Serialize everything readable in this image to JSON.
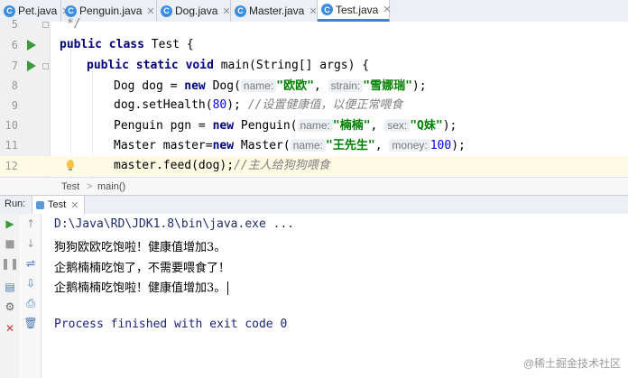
{
  "tabs": [
    {
      "label": "Pet.java",
      "icon": "class-c-icon"
    },
    {
      "label": "Penguin.java",
      "icon": "class-c-icon"
    },
    {
      "label": "Dog.java",
      "icon": "class-c-icon"
    },
    {
      "label": "Master.java",
      "icon": "class-c-icon"
    },
    {
      "label": "Test.java",
      "icon": "class-c-icon",
      "active": true
    }
  ],
  "editor": {
    "lines": [
      {
        "num": "5",
        "text": "*/"
      },
      {
        "num": "6",
        "text": "public class Test {"
      },
      {
        "num": "7",
        "text": "public static void main(String[] args) {"
      },
      {
        "num": "8",
        "text": "Dog dog = new Dog( name: \"欧欧\",  strain: \"雪娜瑞\");"
      },
      {
        "num": "9",
        "text": "dog.setHealth(80); //设置健康值，以便正常喂食"
      },
      {
        "num": "10",
        "text": "Penguin pgn = new Penguin( name: \"楠楠\",  sex: \"Q妹\");"
      },
      {
        "num": "11",
        "text": "Master master=new Master( name: \"王先生\", money: 100);"
      },
      {
        "num": "12",
        "text": "master.feed(dog);//主人给狗狗喂食"
      }
    ],
    "tokens": {
      "l5": "*/",
      "l6_kw1": "public",
      "l6_kw2": "class",
      "l6_rest": " Test {",
      "l7_kw1": "public",
      "l7_kw2": "static",
      "l7_kw3": "void",
      "l7_rest": " main(String[] args) {",
      "l8_a": "Dog dog = ",
      "l8_new": "new",
      "l8_b": " Dog(",
      "l8_h1": "name:",
      "l8_s1": "\"欧欧\"",
      "l8_c": ", ",
      "l8_h2": "strain:",
      "l8_s2": "\"雪娜瑞\"",
      "l8_d": ");",
      "l9_a": "dog.setHealth(",
      "l9_n": "80",
      "l9_b": "); ",
      "l9_cmt": "//设置健康值，以便正常喂食",
      "l10_a": "Penguin pgn = ",
      "l10_new": "new",
      "l10_b": " Penguin(",
      "l10_h1": "name:",
      "l10_s1": "\"楠楠\"",
      "l10_c": ", ",
      "l10_h2": "sex:",
      "l10_s2": "\"Q妹\"",
      "l10_d": ");",
      "l11_a": "Master master=",
      "l11_new": "new",
      "l11_b": " Master(",
      "l11_h1": "name:",
      "l11_s1": "\"王先生\"",
      "l11_c": ", ",
      "l11_h2": "money:",
      "l11_n": "100",
      "l11_d": ");",
      "l12_a": "master.feed(dog);",
      "l12_cmt": "//主人给狗狗喂食"
    }
  },
  "breadcrumb": {
    "class": "Test",
    "sep": ">",
    "method": "main()"
  },
  "run": {
    "label": "Run:",
    "tab": "Test",
    "output": [
      "D:\\Java\\RD\\JDK1.8\\bin\\java.exe ...",
      "狗狗欧欧吃饱啦！健康值增加3。",
      "企鹅楠楠吃饱了，不需要喂食了！",
      "企鹅楠楠吃饱啦！健康值增加3。",
      "Process finished with exit code 0"
    ]
  },
  "watermark": "@稀土掘金技术社区",
  "colors": {
    "accent": "#4083c9",
    "keyword": "#000080",
    "string": "#008000",
    "number": "#0000ff",
    "comment": "#808080"
  }
}
